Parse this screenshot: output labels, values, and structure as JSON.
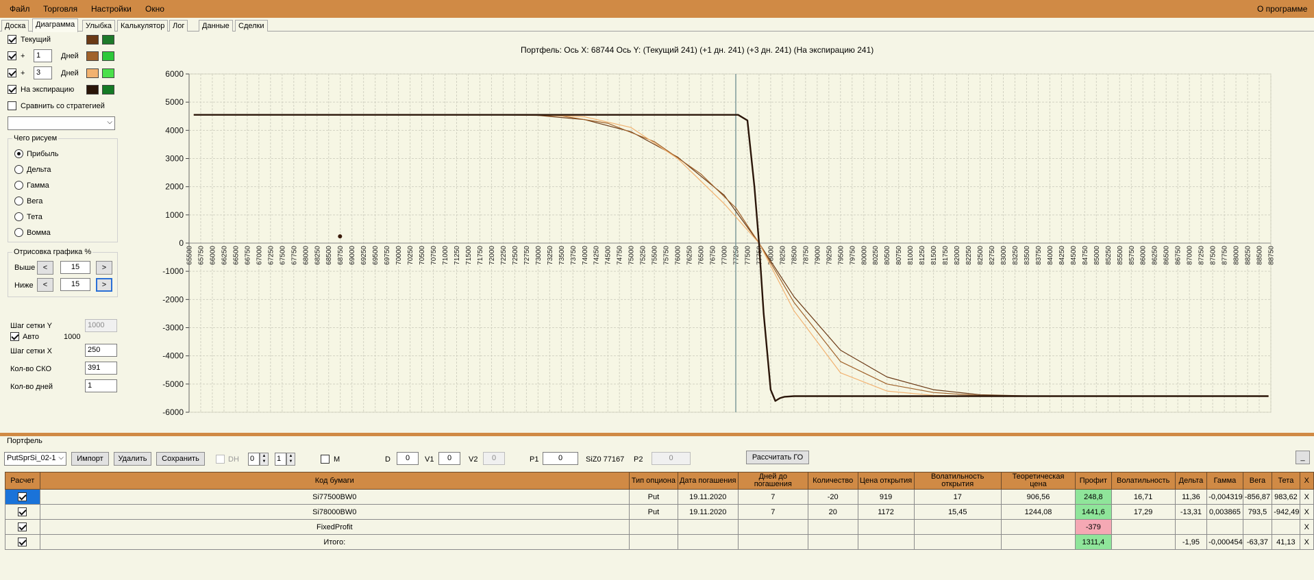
{
  "menu": {
    "file": "Файл",
    "trade": "Торговля",
    "settings": "Настройки",
    "window": "Окно",
    "about": "О программе"
  },
  "tabs": [
    "Доска",
    "Диаграмма",
    "Улыбка",
    "Калькулятор",
    "Лог",
    "Данные",
    "Сделки"
  ],
  "left_panel": {
    "current_label": "Текущий",
    "plus": "+",
    "days_label": "Дней",
    "plus_days_1": "1",
    "plus_days_2": "3",
    "expiration_label": "На экспирацию",
    "compare_label": "Сравнить со стратегией",
    "what_title": "Чего рисуем",
    "radios": [
      "Прибыль",
      "Дельта",
      "Гамма",
      "Вега",
      "Тета",
      "Вомма"
    ],
    "selected_radio": "Прибыль",
    "draw_title": "Отрисовка графика %",
    "above_label": "Выше",
    "below_label": "Ниже",
    "above_value": "15",
    "below_value": "15",
    "prev_arrow": "<",
    "next_arrow": ">",
    "grid_y_label": "Шаг сетки Y",
    "grid_y_value": "1000",
    "auto_label": "Авто",
    "auto_value": "1000",
    "grid_x_label": "Шаг сетки X",
    "grid_x_value": "250",
    "sko_label": "Кол-во СКО",
    "sko_value": "391",
    "days_count_label": "Кол-во дней",
    "days_count_value": "1"
  },
  "colors": {
    "current_curve": "#6b3a16",
    "current_alt": "#1d7a2a",
    "plus1_curve": "#a0622a",
    "plus1_alt": "#2ec83a",
    "plus3_curve": "#f2b270",
    "plus3_alt": "#4ae04a",
    "expiration_curve": "#2a1508",
    "expiration_alt": "#157a25",
    "menu_bar": "#d08a45",
    "profit_positive": "#8fe59a",
    "profit_negative": "#f5a8b4"
  },
  "chart_header": {
    "portfolio": "Портфель:",
    "axis_x": "Ось X:",
    "axis_x_value": "68744",
    "axis_y": "Ось Y:",
    "current": "(Текущий 241)",
    "plus1": "(+1 дн. 241)",
    "plus3": "(+3 дн. 241)",
    "expiration": "(На экспирацию 241)"
  },
  "chart_data": {
    "type": "line",
    "xlim": [
      65500,
      88750
    ],
    "ylim": [
      -6000,
      6000
    ],
    "y_ticks": [
      6000,
      5000,
      4000,
      3000,
      2000,
      1000,
      0,
      -1000,
      -2000,
      -3000,
      -4000,
      -5000,
      -6000
    ],
    "x_tick_step": 250,
    "vertical_marker_x": 77250,
    "cursor_point": {
      "x": 68744,
      "y": 241
    },
    "grid": true,
    "series": [
      {
        "key": "current",
        "color": "#6b3a16",
        "x": [
          65600,
          72000,
          73000,
          74000,
          75000,
          76000,
          77000,
          77750,
          78500,
          79500,
          80500,
          81500,
          82500,
          83500,
          84500,
          85500,
          88700
        ],
        "values": [
          4550,
          4550,
          4530,
          4380,
          3950,
          3050,
          1700,
          0,
          -1900,
          -3800,
          -4750,
          -5200,
          -5380,
          -5420,
          -5430,
          -5430,
          -5430
        ]
      },
      {
        "key": "plus1",
        "color": "#a0622a",
        "x": [
          65600,
          72500,
          73500,
          74500,
          75500,
          76500,
          77250,
          77750,
          78500,
          79500,
          80500,
          81500,
          82500,
          83500,
          84500,
          88700
        ],
        "values": [
          4550,
          4550,
          4510,
          4250,
          3600,
          2450,
          1250,
          0,
          -2100,
          -4200,
          -5000,
          -5300,
          -5410,
          -5430,
          -5430,
          -5430
        ]
      },
      {
        "key": "plus3",
        "color": "#f2b270",
        "x": [
          65600,
          73000,
          74000,
          75000,
          76000,
          77000,
          77750,
          78500,
          79500,
          80500,
          81500,
          82500,
          88700
        ],
        "values": [
          4550,
          4550,
          4480,
          4100,
          3000,
          1400,
          0,
          -2400,
          -4600,
          -5250,
          -5400,
          -5430,
          -5430
        ]
      },
      {
        "key": "expiration",
        "color": "#2a1508",
        "x": [
          65600,
          77000,
          77300,
          77500,
          77650,
          77750,
          77850,
          78000,
          78100,
          78200,
          78300,
          78500,
          88700
        ],
        "values": [
          4550,
          4550,
          4550,
          4350,
          2000,
          0,
          -2500,
          -5200,
          -5600,
          -5500,
          -5450,
          -5430,
          -5430
        ]
      }
    ]
  },
  "portfolio": {
    "title": "Портфель",
    "strategy_select": "PutSprSi_02-1",
    "import": "Импорт",
    "delete": "Удалить",
    "save": "Сохранить",
    "dh_label": "DH",
    "spin1": "0",
    "spin2": "1",
    "m_label": "M",
    "d_label": "D",
    "d_value": "0",
    "v1_label": "V1",
    "v1_value": "0",
    "v2_label": "V2",
    "v2_value": "0",
    "p1_label": "P1",
    "p1_value": "0",
    "siz_label": "SiZ0 77167",
    "p2_label": "P2",
    "p2_value": "0",
    "calc_go": "Рассчитать ГО",
    "min_btn": "_"
  },
  "table": {
    "headers": [
      "Расчет",
      "Код бумаги",
      "Тип опциона",
      "Дата погашения",
      "Дней до погашения",
      "Количество",
      "Цена открытия",
      "Волатильность открытия",
      "Теоретическая цена",
      "Профит",
      "Волатильность",
      "Дельта",
      "Гамма",
      "Вега",
      "Тета",
      "X"
    ],
    "rows": [
      [
        "",
        "Si77500BW0",
        "Put",
        "19.11.2020",
        "7",
        "-20",
        "919",
        "17",
        "906,56",
        "248,8",
        "16,71",
        "11,36",
        "-0,004319",
        "-856,87",
        "983,62",
        "X"
      ],
      [
        "",
        "Si78000BW0",
        "Put",
        "19.11.2020",
        "7",
        "20",
        "1172",
        "15,45",
        "1244,08",
        "1441,6",
        "17,29",
        "-13,31",
        "0,003865",
        "793,5",
        "-942,49",
        "X"
      ],
      [
        "",
        "FixedProfit",
        "",
        "",
        "",
        "",
        "",
        "",
        "",
        "-379",
        "",
        "",
        "",
        "",
        "",
        "X"
      ],
      [
        "",
        "Итого:",
        "",
        "",
        "",
        "",
        "",
        "",
        "",
        "1311,4",
        "",
        "-1,95",
        "-0,000454",
        "-63,37",
        "41,13",
        "X"
      ]
    ]
  }
}
